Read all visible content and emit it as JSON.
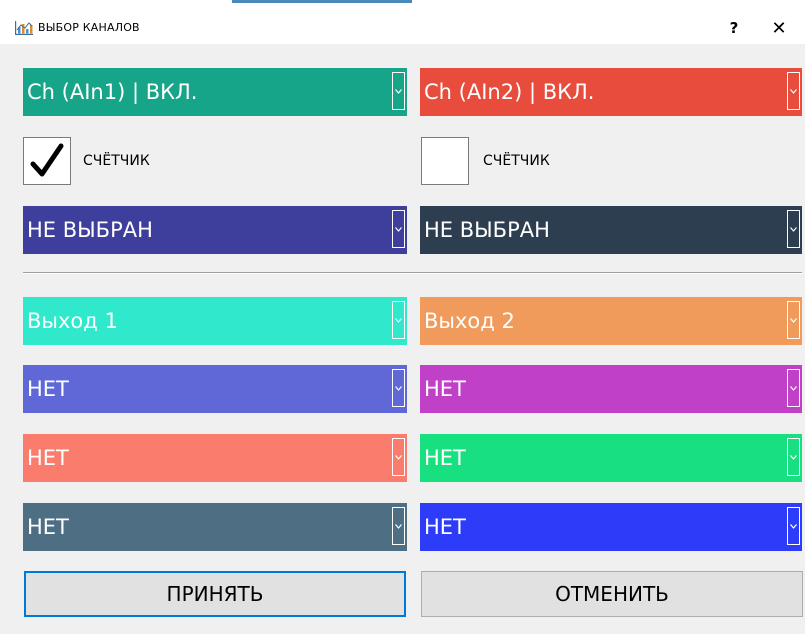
{
  "window": {
    "title": "ВЫБОР КАНАЛОВ",
    "help_label": "?",
    "close_label": "✕"
  },
  "colors": {
    "ch1": "#17a589",
    "ch2": "#e74c3c",
    "sel_left": "#3e3e9c",
    "sel_right": "#2c3e50",
    "out1": "#30e8cc",
    "out2": "#f09a5c",
    "left_row1": "#6068d8",
    "right_row1": "#c040c8",
    "left_row2": "#fa7c6c",
    "right_row2": "#18e080",
    "left_row3": "#4e6e84",
    "right_row3": "#2c3cf8"
  },
  "channels": {
    "left": {
      "value": "Ch (AIn1) | ВКЛ."
    },
    "right": {
      "value": "Ch (AIn2) | ВКЛ."
    }
  },
  "counters": {
    "left": {
      "label": "СЧЁТЧИК",
      "checked": true
    },
    "right": {
      "label": "СЧЁТЧИК",
      "checked": false
    }
  },
  "selects": {
    "left": {
      "value": "НЕ ВЫБРАН"
    },
    "right": {
      "value": "НЕ ВЫБРАН"
    }
  },
  "outputs": {
    "left": [
      {
        "value": "Выход 1"
      },
      {
        "value": "НЕТ"
      },
      {
        "value": "НЕТ"
      },
      {
        "value": "НЕТ"
      }
    ],
    "right": [
      {
        "value": "Выход 2"
      },
      {
        "value": "НЕТ"
      },
      {
        "value": "НЕТ"
      },
      {
        "value": "НЕТ"
      }
    ]
  },
  "buttons": {
    "accept": "ПРИНЯТЬ",
    "cancel": "ОТМЕНИТЬ"
  }
}
